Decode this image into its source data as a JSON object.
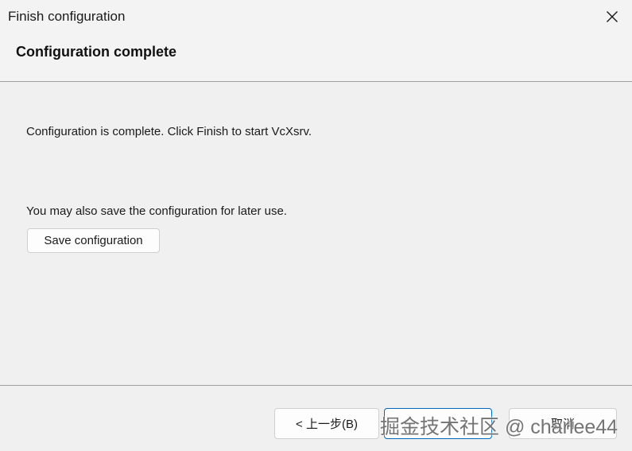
{
  "window": {
    "title": "Finish configuration"
  },
  "header": {
    "heading": "Configuration complete"
  },
  "body": {
    "complete_message": "Configuration is complete. Click Finish to start VcXsrv.",
    "save_message": "You may also save the configuration for later use.",
    "save_button_label": "Save configuration"
  },
  "footer": {
    "back_label": "< 上一步(B)",
    "finish_label": "",
    "cancel_label": "取消"
  },
  "watermark": {
    "text": "掘金技术社区 @ charlee44"
  },
  "colors": {
    "background": "#f0f0f0",
    "focus_border": "#0067c0",
    "separator": "#a0a0a0"
  }
}
